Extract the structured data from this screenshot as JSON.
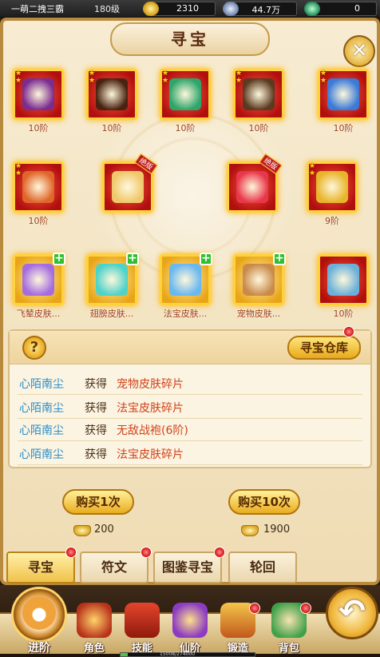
{
  "topbar": {
    "player_name": "一萌二拽三霸",
    "level": "180级",
    "gold": "2310",
    "silver": "44.7万",
    "jade": "0"
  },
  "panel": {
    "title": "寻宝",
    "close_icon": "close-icon"
  },
  "items": [
    {
      "label": "10阶",
      "tag": "",
      "plus": false,
      "stars": "★\n★",
      "bg": "red",
      "color": "#7b2c8f"
    },
    {
      "label": "10阶",
      "tag": "",
      "plus": false,
      "stars": "★\n★",
      "bg": "red",
      "color": "#4a2310"
    },
    {
      "label": "10阶",
      "tag": "",
      "plus": false,
      "stars": "★\n★",
      "bg": "red",
      "color": "#2fa56b"
    },
    {
      "label": "10阶",
      "tag": "",
      "plus": false,
      "stars": "★\n★",
      "bg": "red",
      "color": "#5a3a20"
    },
    {
      "label": "10阶",
      "tag": "",
      "plus": false,
      "stars": "★\n★",
      "bg": "red",
      "color": "#3b7ad6"
    },
    {
      "label": "10阶",
      "tag": "",
      "plus": false,
      "stars": "★\n★",
      "bg": "red",
      "color": "#e0652a"
    },
    {
      "label": "",
      "tag": "绝版",
      "plus": false,
      "stars": "",
      "bg": "red",
      "color": "#f0c86a"
    },
    {
      "label": "",
      "tag": "绝版",
      "plus": false,
      "stars": "",
      "bg": "red",
      "color": "#e8374a"
    },
    {
      "label": "9阶",
      "tag": "",
      "plus": false,
      "stars": "★\n★",
      "bg": "red",
      "color": "#e8b42a"
    },
    {
      "label": "飞辇皮肤...",
      "tag": "",
      "plus": true,
      "stars": "",
      "bg": "gold",
      "color": "#a46ce0"
    },
    {
      "label": "翅膀皮肤...",
      "tag": "",
      "plus": true,
      "stars": "",
      "bg": "gold",
      "color": "#4fd2c8"
    },
    {
      "label": "法宝皮肤...",
      "tag": "",
      "plus": true,
      "stars": "",
      "bg": "gold",
      "color": "#6ab8f0"
    },
    {
      "label": "宠物皮肤...",
      "tag": "",
      "plus": true,
      "stars": "",
      "bg": "gold",
      "color": "#c98a4a"
    },
    {
      "label": "10阶",
      "tag": "",
      "plus": false,
      "stars": "",
      "bg": "red",
      "color": "#6bb0d8"
    }
  ],
  "log": {
    "help_label": "?",
    "warehouse_label": "寻宝仓库",
    "entries": [
      {
        "who": "心陌南尘",
        "verb": "获得",
        "what": "宠物皮肤碎片"
      },
      {
        "who": "心陌南尘",
        "verb": "获得",
        "what": "法宝皮肤碎片"
      },
      {
        "who": "心陌南尘",
        "verb": "获得",
        "what": "无敌战袍(6阶)"
      },
      {
        "who": "心陌南尘",
        "verb": "获得",
        "what": "法宝皮肤碎片"
      }
    ]
  },
  "buy": {
    "once_label": "购买1次",
    "once_cost": "200",
    "ten_label": "购买10次",
    "ten_cost": "1900"
  },
  "tabs": [
    "寻宝",
    "符文",
    "图鉴寻宝",
    "轮回"
  ],
  "nav": {
    "main_label": "进阶",
    "items": [
      "角色",
      "技能",
      "仙阶",
      "锻造",
      "背包"
    ],
    "back_icon": "back-arrow-icon",
    "exp_text": "15008/274000",
    "exp_progress": 0.055
  },
  "colors": {
    "accent_gold": "#e9ad20",
    "log_name": "#2a8ec9",
    "log_item": "#d0431a"
  }
}
